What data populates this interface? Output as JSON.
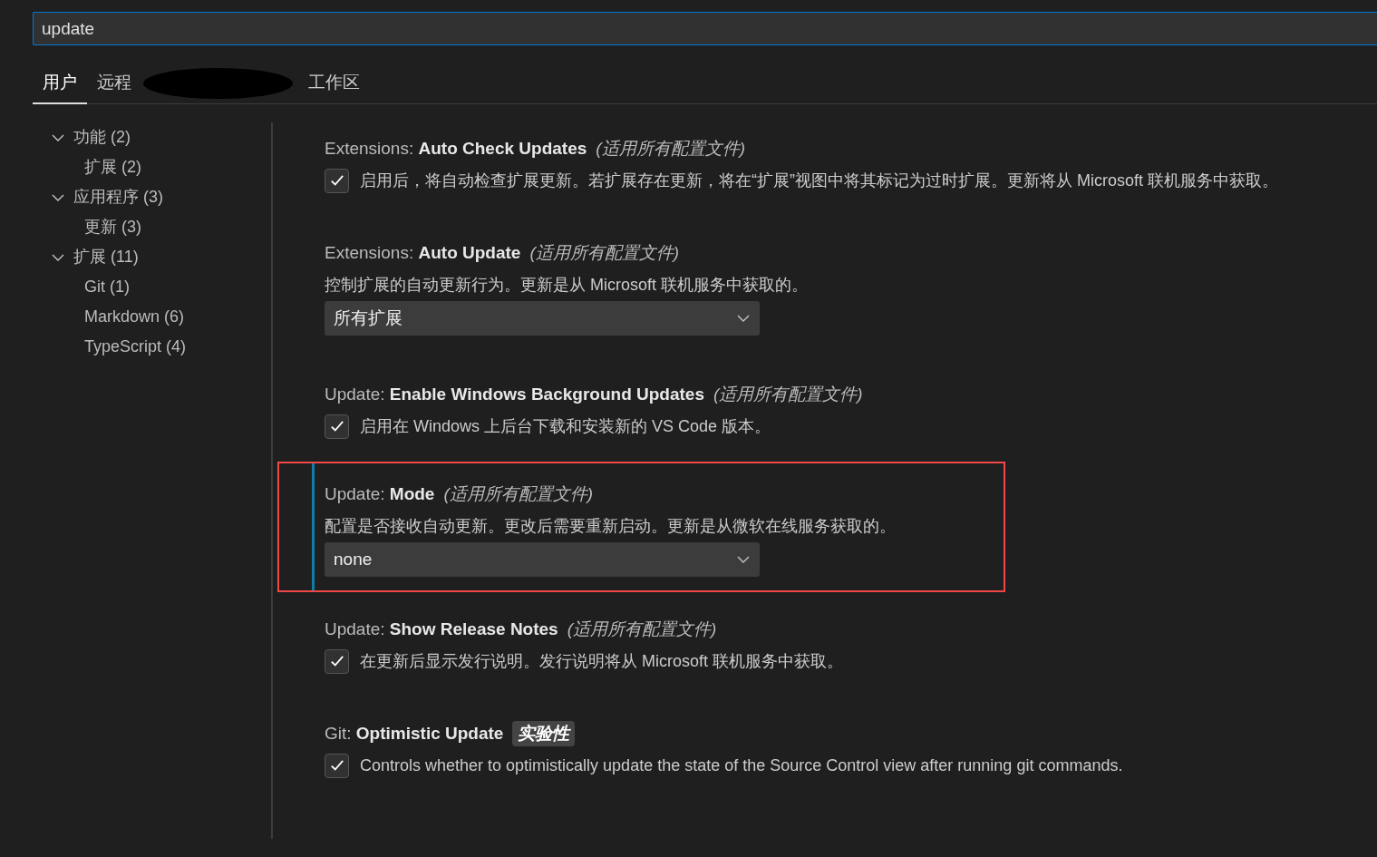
{
  "search": {
    "value": "update"
  },
  "tabs": [
    {
      "label": "用户",
      "selected": true,
      "redacted": false
    },
    {
      "label": "远程",
      "selected": false,
      "redacted": true
    },
    {
      "label": "工作区",
      "selected": false,
      "redacted": false
    }
  ],
  "tree": [
    {
      "label": "功能 (2)",
      "expanded": true,
      "children": [
        {
          "label": "扩展 (2)"
        }
      ]
    },
    {
      "label": "应用程序 (3)",
      "expanded": true,
      "children": [
        {
          "label": "更新 (3)"
        }
      ]
    },
    {
      "label": "扩展 (11)",
      "expanded": true,
      "children": [
        {
          "label": "Git (1)"
        },
        {
          "label": "Markdown (6)"
        },
        {
          "label": "TypeScript (4)"
        }
      ]
    }
  ],
  "settings": [
    {
      "kind": "checkbox",
      "category": "Extensions:",
      "name": "Auto Check Updates",
      "scope": "(适用所有配置文件)",
      "description": "启用后，将自动检查扩展更新。若扩展存在更新，将在“扩展”视图中将其标记为过时扩展。更新将从 Microsoft 联机服务中获取。",
      "checked": true,
      "focused": false,
      "highlighted": false
    },
    {
      "kind": "select",
      "category": "Extensions:",
      "name": "Auto Update",
      "scope": "(适用所有配置文件)",
      "description": "控制扩展的自动更新行为。更新是从 Microsoft 联机服务中获取的。",
      "value": "所有扩展",
      "focused": false,
      "highlighted": false
    },
    {
      "kind": "checkbox",
      "category": "Update:",
      "name": "Enable Windows Background Updates",
      "scope": "(适用所有配置文件)",
      "description": "启用在 Windows 上后台下载和安装新的 VS Code 版本。",
      "checked": true,
      "focused": false,
      "highlighted": false
    },
    {
      "kind": "select",
      "category": "Update:",
      "name": "Mode",
      "scope": "(适用所有配置文件)",
      "description": "配置是否接收自动更新。更改后需要重新启动。更新是从微软在线服务获取的。",
      "value": "none",
      "focused": true,
      "highlighted": true
    },
    {
      "kind": "checkbox",
      "category": "Update:",
      "name": "Show Release Notes",
      "scope": "(适用所有配置文件)",
      "description": "在更新后显示发行说明。发行说明将从 Microsoft 联机服务中获取。",
      "checked": true,
      "focused": false,
      "highlighted": false
    },
    {
      "kind": "checkbox",
      "category": "Git:",
      "name": "Optimistic Update",
      "tag": "实验性",
      "description": "Controls whether to optimistically update the state of the Source Control view after running git commands.",
      "checked": true,
      "focused": false,
      "highlighted": false
    }
  ]
}
